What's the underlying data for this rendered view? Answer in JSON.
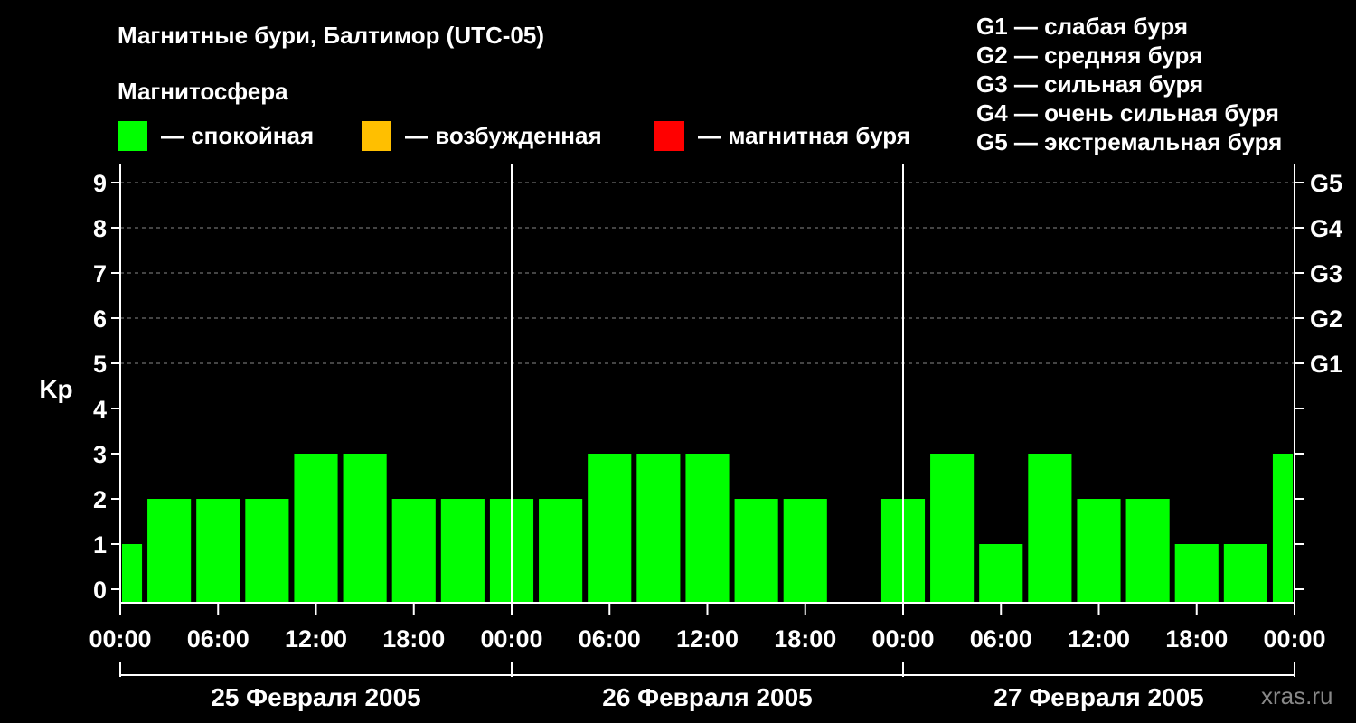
{
  "header": {
    "title": "Магнитные бури, Балтимор (UTC-05)",
    "subtitle": "Магнитосфера",
    "watermark": "xras.ru"
  },
  "legend": [
    {
      "label": "— спокойная",
      "color": "#00ff00"
    },
    {
      "label": "— возбужденная",
      "color": "#ffbf00"
    },
    {
      "label": "— магнитная буря",
      "color": "#ff0000"
    }
  ],
  "g_scale": [
    "G1 — слабая буря",
    "G2 — средняя буря",
    "G3 — сильная буря",
    "G4 — очень сильная буря",
    "G5 — экстремальная буря"
  ],
  "chart_data": {
    "type": "bar",
    "ylabel": "Kp",
    "ylim": [
      0,
      9
    ],
    "yticks": [
      0,
      1,
      2,
      3,
      4,
      5,
      6,
      7,
      8,
      9
    ],
    "right_axis_labels": [
      {
        "kp": 5,
        "label": "G1"
      },
      {
        "kp": 6,
        "label": "G2"
      },
      {
        "kp": 7,
        "label": "G3"
      },
      {
        "kp": 8,
        "label": "G4"
      },
      {
        "kp": 9,
        "label": "G5"
      }
    ],
    "xtick_labels": [
      "00:00",
      "06:00",
      "12:00",
      "18:00",
      "00:00",
      "06:00",
      "12:00",
      "18:00",
      "00:00",
      "06:00",
      "12:00",
      "18:00",
      "00:00"
    ],
    "days": [
      "25 Февраля 2005",
      "26 Февраля 2005",
      "27 Февраля 2005"
    ],
    "bar_hours": [
      0,
      3,
      6,
      9,
      12,
      15,
      18,
      21,
      24,
      27,
      30,
      33,
      36,
      39,
      42,
      45,
      48,
      51,
      54,
      57,
      60,
      63,
      66,
      69,
      72
    ],
    "values": [
      1,
      2,
      2,
      2,
      3,
      3,
      2,
      2,
      2,
      2,
      3,
      3,
      3,
      2,
      2,
      0,
      2,
      3,
      1,
      3,
      2,
      2,
      1,
      1,
      3
    ],
    "bar_color": "#00ff00",
    "grid": true,
    "grid_style": "dashed"
  }
}
